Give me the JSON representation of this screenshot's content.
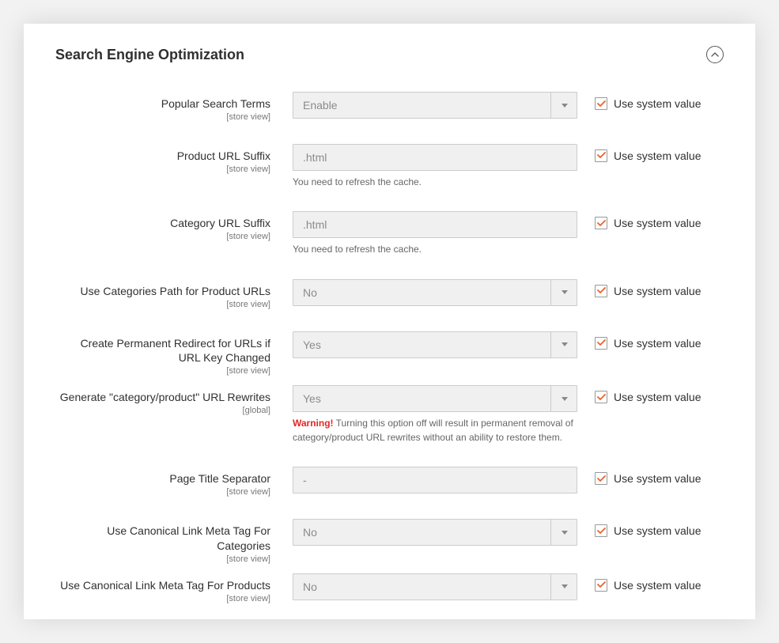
{
  "panel": {
    "title": "Search Engine Optimization"
  },
  "common": {
    "use_system_value": "Use system value",
    "scope_store": "[store view]",
    "scope_global": "[global]"
  },
  "fields": {
    "popular_search_terms": {
      "label": "Popular Search Terms",
      "value": "Enable"
    },
    "product_url_suffix": {
      "label": "Product URL Suffix",
      "value": ".html",
      "hint": "You need to refresh the cache."
    },
    "category_url_suffix": {
      "label": "Category URL Suffix",
      "value": ".html",
      "hint": "You need to refresh the cache."
    },
    "use_categories_path": {
      "label": "Use Categories Path for Product URLs",
      "value": "No"
    },
    "permanent_redirect": {
      "label": "Create Permanent Redirect for URLs if URL Key Changed",
      "value": "Yes"
    },
    "generate_rewrites": {
      "label": "Generate \"category/product\" URL Rewrites",
      "value": "Yes",
      "warn_label": "Warning!",
      "warn_text": " Turning this option off will result in permanent removal of category/product URL rewrites without an ability to restore them."
    },
    "page_title_separator": {
      "label": "Page Title Separator",
      "value": "-"
    },
    "canonical_categories": {
      "label": "Use Canonical Link Meta Tag For Categories",
      "value": "No"
    },
    "canonical_products": {
      "label": "Use Canonical Link Meta Tag For Products",
      "value": "No"
    }
  }
}
